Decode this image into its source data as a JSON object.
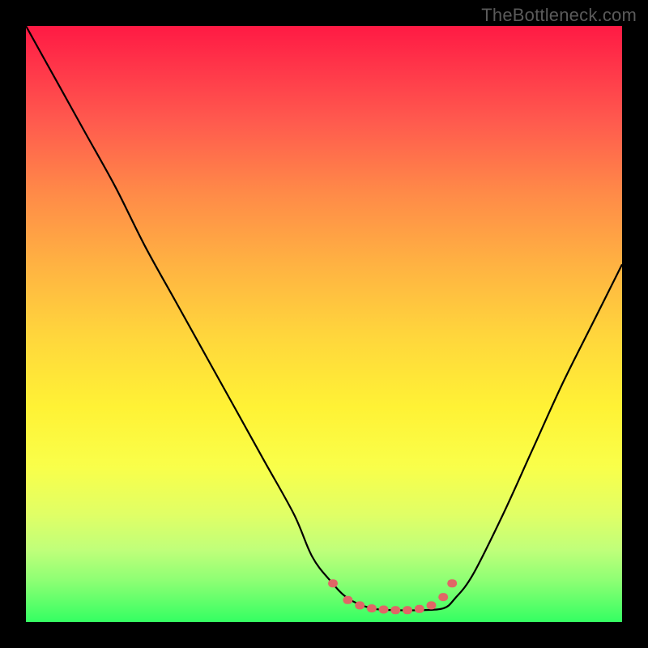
{
  "watermark": "TheBottleneck.com",
  "colors": {
    "frame": "#000000",
    "curve": "#000000",
    "dot": "#e06666"
  },
  "chart_data": {
    "type": "line",
    "title": "",
    "xlabel": "",
    "ylabel": "",
    "xlim": [
      0,
      100
    ],
    "ylim": [
      0,
      100
    ],
    "grid": false,
    "legend": false,
    "series": [
      {
        "name": "curve",
        "x": [
          0,
          5,
          10,
          15,
          20,
          25,
          30,
          35,
          40,
          45,
          48,
          51,
          54,
          58,
          62,
          66,
          70,
          72,
          75,
          80,
          85,
          90,
          95,
          100
        ],
        "y": [
          100,
          91,
          82,
          73,
          63,
          54,
          45,
          36,
          27,
          18,
          11,
          7,
          4,
          2.3,
          2.0,
          2.0,
          2.3,
          4,
          8,
          18,
          29,
          40,
          50,
          60
        ]
      }
    ],
    "dots": {
      "name": "highlight-dots",
      "x": [
        51.5,
        54,
        56,
        58,
        60,
        62,
        64,
        66,
        68,
        70,
        71.5
      ],
      "y": [
        6.5,
        3.7,
        2.8,
        2.3,
        2.1,
        2.0,
        2.0,
        2.2,
        2.8,
        4.2,
        6.5
      ]
    }
  }
}
